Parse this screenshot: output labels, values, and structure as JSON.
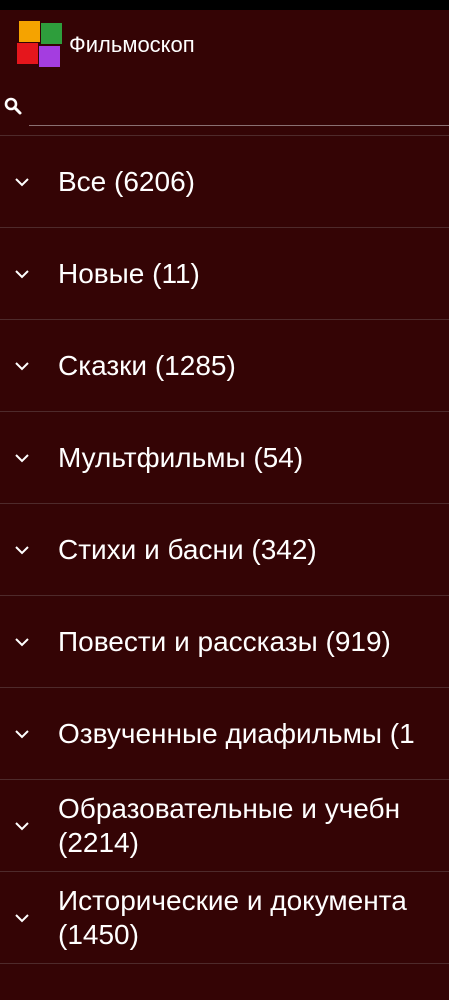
{
  "app": {
    "title": "Фильмоскоп",
    "logo_colors": [
      "#f5a300",
      "#2e9e3c",
      "#e5161c",
      "#a43de0"
    ]
  },
  "search": {
    "placeholder": "",
    "value": "",
    "icon": "search-icon"
  },
  "colors": {
    "background": "#340405",
    "divider": "#4e2a2b",
    "text": "#ffffff"
  },
  "categories": [
    {
      "label": "Все (6206)",
      "icon": "chevron-down-icon"
    },
    {
      "label": "Новые (11)",
      "icon": "chevron-down-icon"
    },
    {
      "label": "Сказки (1285)",
      "icon": "chevron-down-icon"
    },
    {
      "label": "Мультфильмы (54)",
      "icon": "chevron-down-icon"
    },
    {
      "label": "Стихи и басни (342)",
      "icon": "chevron-down-icon"
    },
    {
      "label": "Повести и рассказы (919)",
      "icon": "chevron-down-icon"
    },
    {
      "label": "Озвученные диафильмы (1",
      "icon": "chevron-down-icon"
    },
    {
      "label": "Образовательные и учебн\n(2214)",
      "icon": "chevron-down-icon"
    },
    {
      "label": "Исторические и документа\n(1450)",
      "icon": "chevron-down-icon"
    }
  ]
}
